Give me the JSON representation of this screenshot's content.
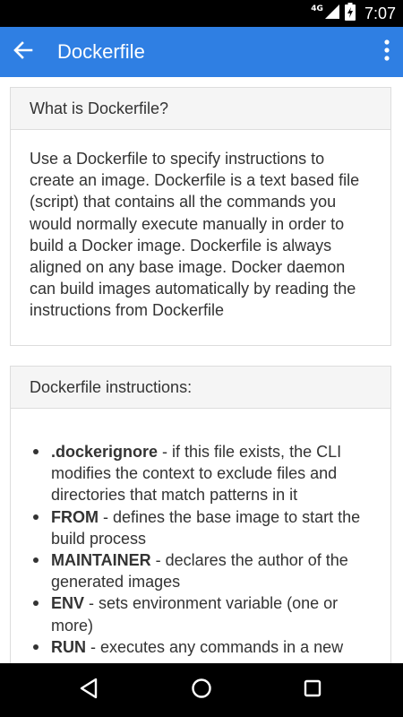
{
  "status_bar": {
    "network": "4G",
    "time": "7:07",
    "icons": [
      "signal-icon",
      "battery-charging-icon"
    ]
  },
  "app_bar": {
    "title": "Dockerfile",
    "back_icon": "arrow-back-icon",
    "menu_icon": "more-vert-icon",
    "color": "#2f7fe3"
  },
  "sections": [
    {
      "title": "What is Dockerfile?",
      "text": "Use a Dockerfile to specify instructions to create an image. Dockerfile is a text based file (script) that contains all the commands you would normally execute manually in order to build a Docker image. Dockerfile is always aligned on any base image. Docker daemon can build images automatically by reading the instructions from Dockerfile"
    },
    {
      "title": "Dockerfile instructions:",
      "items": [
        {
          "name": ".dockerignore",
          "desc": " - if this file exists, the CLI modifies the context to exclude files and directories that match patterns in it"
        },
        {
          "name": "FROM",
          "desc": " - defines the base image to start the build process"
        },
        {
          "name": "MAINTAINER",
          "desc": " - declares the author of the generated images"
        },
        {
          "name": "ENV",
          "desc": " - sets environment variable (one or more)"
        },
        {
          "name": "RUN",
          "desc": " - executes any commands in a new"
        }
      ]
    }
  ],
  "nav_bar": {
    "icons": [
      "back-triangle-icon",
      "home-circle-icon",
      "recents-square-icon"
    ]
  }
}
